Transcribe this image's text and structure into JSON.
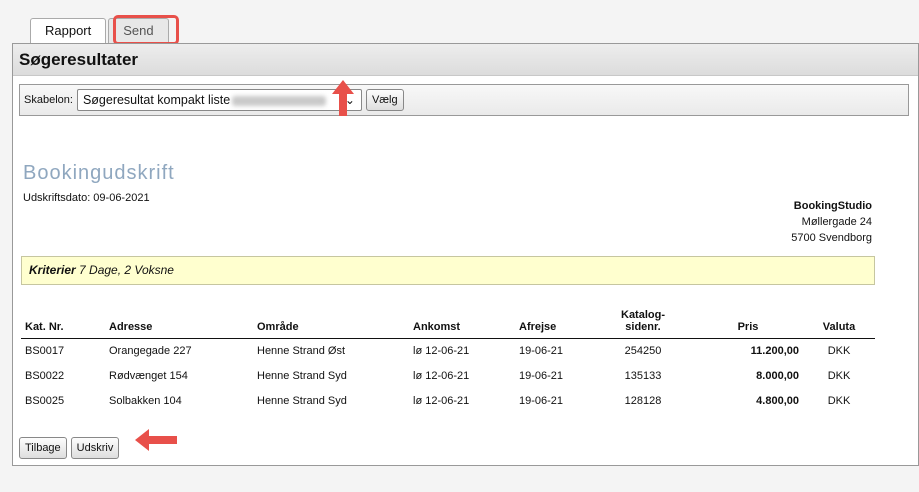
{
  "tabs": [
    {
      "label": "Rapport"
    },
    {
      "label": "Send"
    }
  ],
  "header": {
    "title": "Søgeresultater"
  },
  "toolbar": {
    "template_label": "Skabelon:",
    "template_value": "Søgeresultat kompakt liste",
    "choose_button": "Vælg"
  },
  "report": {
    "title": "Bookingudskrift",
    "print_date": "Udskriftsdato: 09-06-2021",
    "company": {
      "name": "BookingStudio",
      "street": "Møllergade 24",
      "city": "5700 Svendborg"
    },
    "criteria_label": "Kriterier",
    "criteria_value": "7 Dage, 2 Voksne"
  },
  "table": {
    "headers": {
      "id": "Kat. Nr.",
      "address": "Adresse",
      "area": "Område",
      "arrival": "Ankomst",
      "departure": "Afrejse",
      "catalog_1": "Katalog-",
      "catalog_2": "sidenr.",
      "price": "Pris",
      "currency": "Valuta"
    },
    "rows": [
      {
        "id": "BS0017",
        "address": "Orangegade 227",
        "area": "Henne Strand Øst",
        "arrival": "lø 12-06-21",
        "departure": "19-06-21",
        "catalog": "254250",
        "price": "11.200,00",
        "currency": "DKK"
      },
      {
        "id": "BS0022",
        "address": "Rødvænget 154",
        "area": "Henne Strand Syd",
        "arrival": "lø 12-06-21",
        "departure": "19-06-21",
        "catalog": "135133",
        "price": "8.000,00",
        "currency": "DKK"
      },
      {
        "id": "BS0025",
        "address": "Solbakken 104",
        "area": "Henne Strand Syd",
        "arrival": "lø 12-06-21",
        "departure": "19-06-21",
        "catalog": "128128",
        "price": "4.800,00",
        "currency": "DKK"
      }
    ]
  },
  "buttons": {
    "back": "Tilbage",
    "print": "Udskriv"
  },
  "annotations": {
    "color": "#e8504a"
  },
  "icons": {
    "select_chevron": "chevron-down-icon"
  }
}
